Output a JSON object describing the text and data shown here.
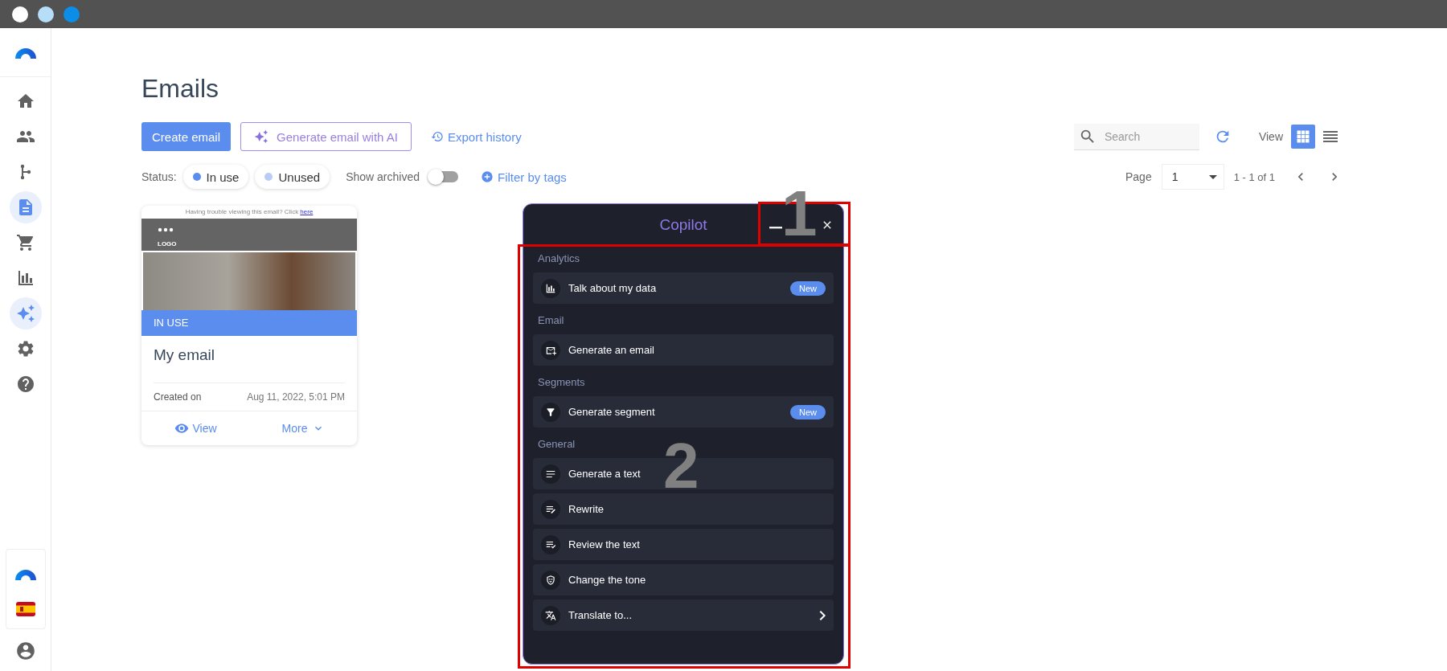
{
  "window_controls": [
    {
      "color": "#ffffff"
    },
    {
      "color": "#b7def8"
    },
    {
      "color": "#0c8ee8"
    }
  ],
  "sidebar": {
    "items": [
      {
        "selected": false
      },
      {
        "selected": false
      },
      {
        "selected": false
      },
      {
        "selected": true
      },
      {
        "selected": false
      },
      {
        "selected": false
      },
      {
        "selected": true
      },
      {
        "selected": false
      },
      {
        "selected": false
      }
    ]
  },
  "page": {
    "title": "Emails"
  },
  "toolbar": {
    "create_button": "Create email",
    "ai_button": "Generate email with AI",
    "export_link": "Export history",
    "search": {
      "placeholder": "Search"
    },
    "view_label": "View",
    "views": [
      {
        "selected": true
      },
      {
        "selected": false
      }
    ]
  },
  "filters": {
    "status_label": "Status:",
    "chips": [
      {
        "label": "In use",
        "color": "#5b8def"
      },
      {
        "label": "Unused",
        "color": "#b7cdf5"
      }
    ],
    "archived_label": "Show archived",
    "archived_on": false,
    "tags_link": "Filter by tags"
  },
  "pagination": {
    "page_label": "Page",
    "page_value": "1",
    "range": "1 - 1 of 1"
  },
  "cards": [
    {
      "preheader": "Having trouble viewing this email? Click",
      "preheader_link": "here",
      "logo": "LOGO",
      "status": "IN USE",
      "title": "My email",
      "created_label": "Created on",
      "created_value": "Aug 11, 2022, 5:01 PM",
      "view_action": "View",
      "more_action": "More"
    }
  ],
  "copilot": {
    "title": "Copilot",
    "sections": [
      {
        "title": "Analytics",
        "items": [
          {
            "label": "Talk about my data",
            "badge": "New",
            "submenu": false
          }
        ]
      },
      {
        "title": "Email",
        "items": [
          {
            "label": "Generate an email",
            "submenu": false
          }
        ]
      },
      {
        "title": "Segments",
        "items": [
          {
            "label": "Generate segment",
            "badge": "New",
            "submenu": false
          }
        ]
      },
      {
        "title": "General",
        "items": [
          {
            "label": "Generate a text",
            "submenu": false
          },
          {
            "label": "Rewrite",
            "submenu": false
          },
          {
            "label": "Review the text",
            "submenu": false
          },
          {
            "label": "Change the tone",
            "submenu": false
          },
          {
            "label": "Translate to...",
            "submenu": true
          }
        ]
      }
    ]
  },
  "annotations": [
    {
      "label": "1"
    },
    {
      "label": "2"
    }
  ]
}
